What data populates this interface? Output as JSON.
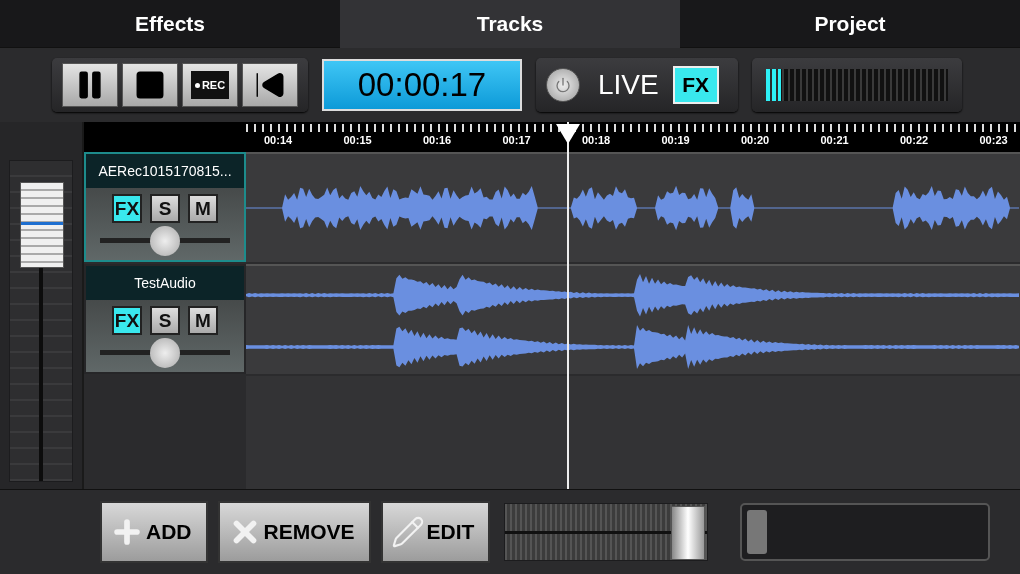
{
  "tabs": [
    {
      "label": "Effects",
      "selected": false
    },
    {
      "label": "Tracks",
      "selected": true
    },
    {
      "label": "Project",
      "selected": false
    }
  ],
  "transport": [
    {
      "kind": "pause"
    },
    {
      "kind": "stop"
    },
    {
      "kind": "rec",
      "label": "REC"
    },
    {
      "kind": "rewind"
    }
  ],
  "time_display": "00:00:17",
  "live": {
    "label": "LIVE",
    "fx_label": "FX",
    "fx_on": true
  },
  "meter": {
    "level": 0.08
  },
  "ruler": [
    "00:14",
    "00:15",
    "00:16",
    "00:17",
    "00:18",
    "00:19",
    "00:20",
    "00:21",
    "00:22",
    "00:23"
  ],
  "tracks": [
    {
      "name": "AERec1015170815...",
      "selected": true,
      "fx": "FX",
      "fx_on": true,
      "solo": "S",
      "solo_on": false,
      "mute": "M",
      "mute_on": false,
      "level": 0.5,
      "kind": "mono"
    },
    {
      "name": "TestAudio",
      "selected": false,
      "fx": "FX",
      "fx_on": true,
      "solo": "S",
      "solo_on": false,
      "mute": "M",
      "mute_on": false,
      "level": 0.5,
      "kind": "stereo"
    }
  ],
  "master_fader": {
    "level": 0.8
  },
  "bottom_buttons": [
    {
      "kind": "add",
      "label": "ADD"
    },
    {
      "kind": "remove",
      "label": "REMOVE"
    },
    {
      "kind": "edit",
      "label": "EDIT"
    }
  ],
  "zoom_slider": {
    "level": 0.9
  }
}
